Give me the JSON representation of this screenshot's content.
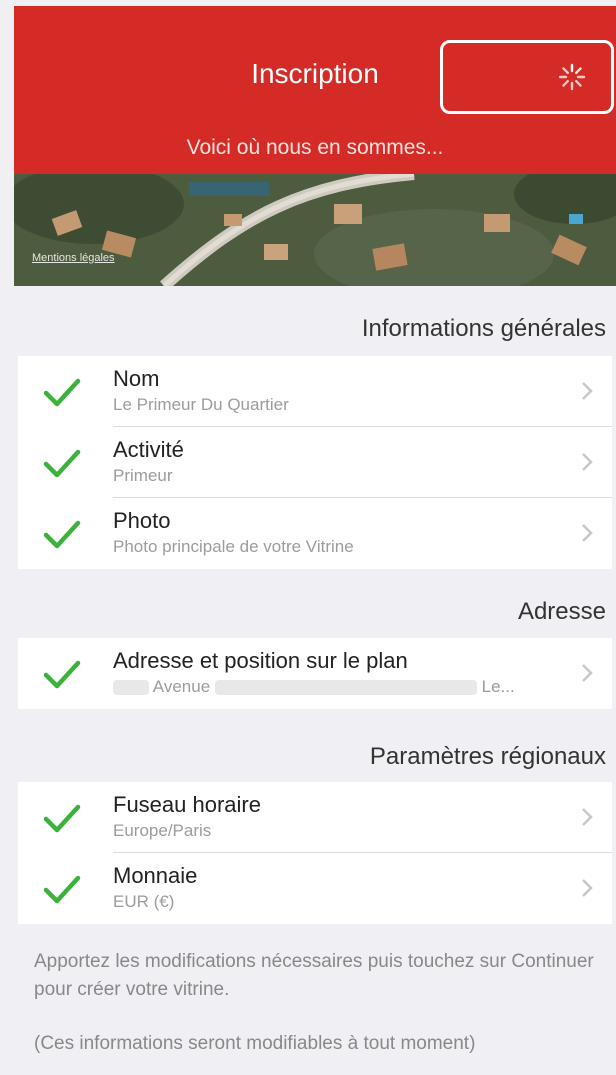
{
  "header": {
    "title": "Inscription",
    "subtitle": "Voici où nous en sommes...",
    "background": "#d52b27",
    "loading_icon": "spinner-icon"
  },
  "map": {
    "credit": "Mentions légales"
  },
  "sections": [
    {
      "title": "Informations générales",
      "rows": [
        {
          "label": "Nom",
          "detail": "Le Primeur Du Quartier"
        },
        {
          "label": "Activité",
          "detail": "Primeur"
        },
        {
          "label": "Photo",
          "detail": "Photo principale de votre Vitrine"
        }
      ]
    },
    {
      "title": "Adresse",
      "rows": [
        {
          "label": "Adresse et position sur le plan",
          "detail_street": "Avenue",
          "detail_city": "Le..."
        }
      ]
    },
    {
      "title": "Paramètres régionaux",
      "rows": [
        {
          "label": "Fuseau horaire",
          "detail": "Europe/Paris"
        },
        {
          "label": "Monnaie",
          "detail": "EUR (€)"
        }
      ]
    }
  ],
  "footer": {
    "instructions": "Apportez les modifications nécessaires puis touchez sur Continuer pour créer votre vitrine.",
    "note": "(Ces informations seront modifiables à tout moment)"
  },
  "colors": {
    "check": "#3cb23c",
    "chevron": "#c7c7cc",
    "background": "#f0eff4"
  }
}
